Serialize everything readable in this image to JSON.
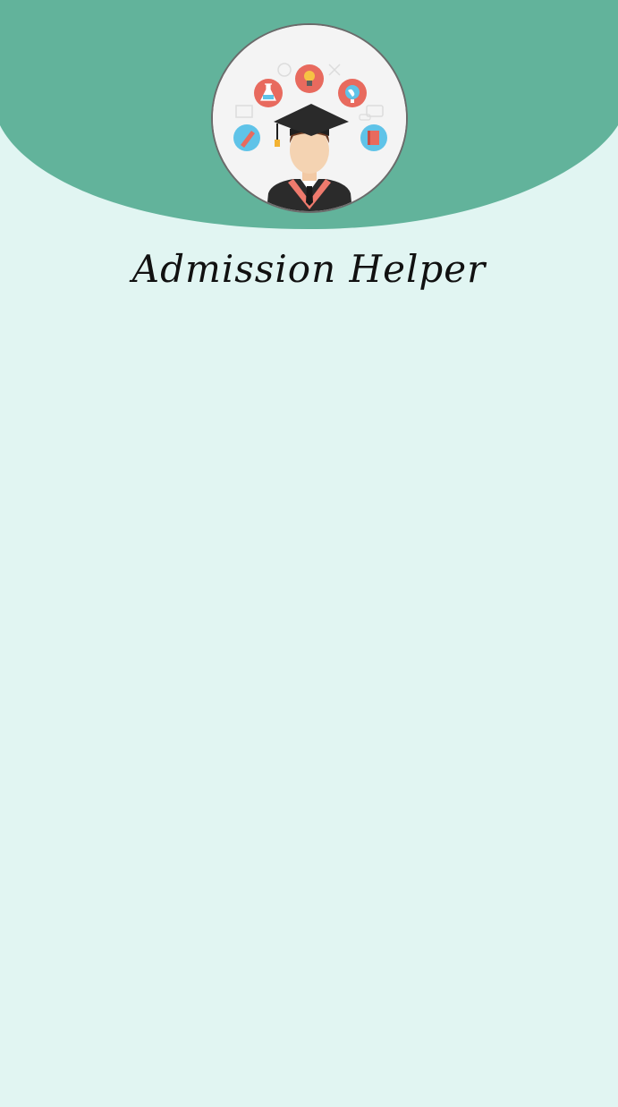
{
  "app": {
    "title": "Admission Helper"
  },
  "colors": {
    "header_green": "#62b39b",
    "background_mint": "#e1f5f2",
    "logo_ring": "#6b6b6b",
    "title_text": "#111111"
  },
  "icons": {
    "logo": "graduate-with-cap-icon",
    "orbit_icons": [
      "flask-icon",
      "lightbulb-icon",
      "globe-icon",
      "pencil-icon",
      "book-icon"
    ]
  }
}
